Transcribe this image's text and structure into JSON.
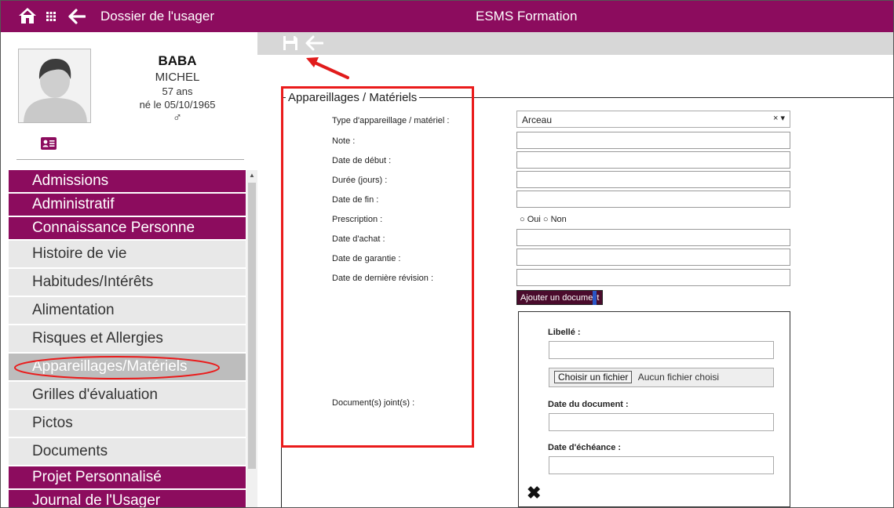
{
  "header": {
    "title": "Dossier de l'usager",
    "org": "ESMS Formation"
  },
  "patient": {
    "last_name": "BABA",
    "first_name": "MICHEL",
    "age": "57 ans",
    "birth": "né le 05/10/1965",
    "sex_symbol": "♂"
  },
  "menu": [
    {
      "label": "Admissions",
      "kind": "header"
    },
    {
      "label": "Administratif",
      "kind": "header"
    },
    {
      "label": "Connaissance Personne",
      "kind": "header"
    },
    {
      "label": "Histoire de vie",
      "kind": "sub"
    },
    {
      "label": "Habitudes/Intérêts",
      "kind": "sub"
    },
    {
      "label": "Alimentation",
      "kind": "sub"
    },
    {
      "label": "Risques et Allergies",
      "kind": "sub"
    },
    {
      "label": "Appareillages/Matériels",
      "kind": "sub",
      "active": true
    },
    {
      "label": "Grilles d'évaluation",
      "kind": "sub"
    },
    {
      "label": "Pictos",
      "kind": "sub"
    },
    {
      "label": "Documents",
      "kind": "sub"
    },
    {
      "label": "Projet Personnalisé",
      "kind": "header"
    },
    {
      "label": "Journal de l'Usager",
      "kind": "header"
    }
  ],
  "form": {
    "legend": "Appareillages / Matériels",
    "labels": {
      "type": "Type d'appareillage / matériel :",
      "note": "Note :",
      "start": "Date de début :",
      "duration": "Durée (jours) :",
      "end": "Date de fin :",
      "prescription": "Prescription :",
      "purchase": "Date d'achat :",
      "warranty": "Date de garantie :",
      "revision": "Date de dernière révision :",
      "documents": "Document(s) joint(s) :"
    },
    "type_value": "Arceau",
    "select_controls": "× ▾",
    "prescription_options": {
      "yes": "Oui",
      "no": "Non"
    },
    "add_document_prefix": "Ajouter un docume",
    "add_document_suffix": "t"
  },
  "doc_panel": {
    "label_title": "Libellé :",
    "file_button": "Choisir un fichier",
    "file_none": "Aucun fichier choisi",
    "doc_date": "Date du document :",
    "due_date": "Date d'échéance :",
    "delete_symbol": "✖"
  },
  "colors": {
    "brand": "#8c0c5e",
    "highlight": "#ea1b1b"
  }
}
